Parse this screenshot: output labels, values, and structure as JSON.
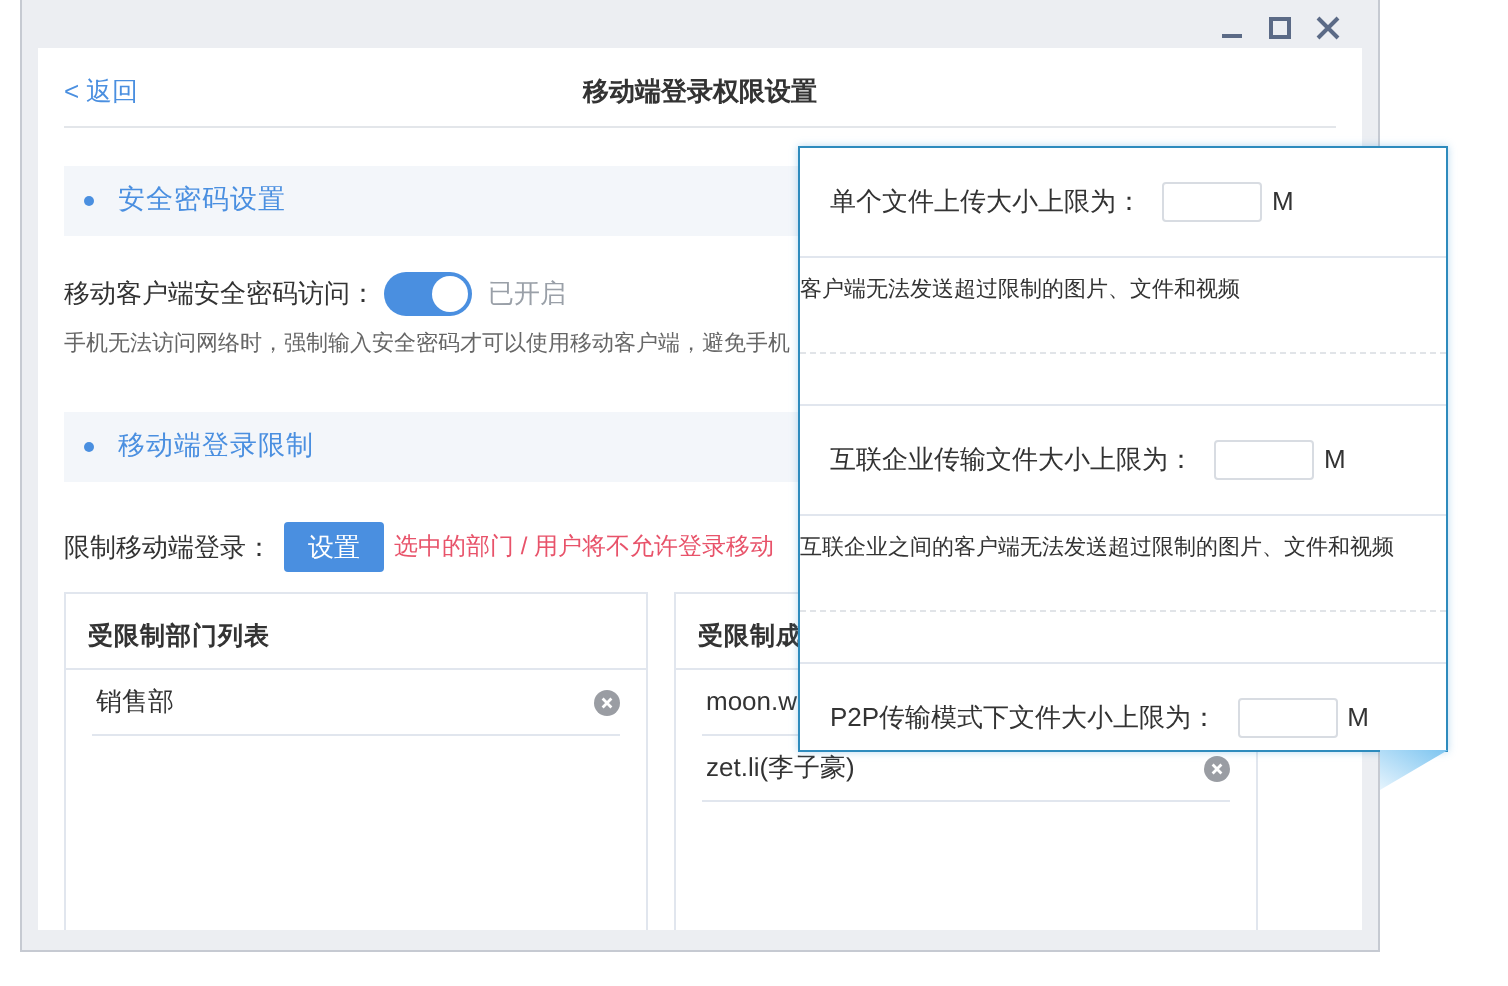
{
  "header": {
    "back": "< 返回",
    "title": "移动端登录权限设置"
  },
  "password_section": {
    "title": "安全密码设置",
    "toggle_label": "移动客户端安全密码访问：",
    "on": true,
    "status": "已开启",
    "description": "手机无法访问网络时，强制输入安全密码才可以使用移动客户端，避免手机"
  },
  "login_section": {
    "title": "移动端登录限制",
    "label": "限制移动端登录：",
    "button": "设置",
    "hint": "选中的部门 / 用户将不允许登录移动"
  },
  "lists": [
    {
      "title": "受限制部门列表",
      "items": [
        {
          "text": "销售部",
          "remove_icon": true
        }
      ]
    },
    {
      "title": "受限制成",
      "items": [
        {
          "text": "moon.w",
          "remove_icon": false
        },
        {
          "text": "zet.li(李子豪)",
          "remove_icon": true
        }
      ]
    }
  ],
  "popup": {
    "limits": [
      {
        "label": "单个文件上传大小上限为：",
        "unit": "M",
        "note": "客户端无法发送超过限制的图片、文件和视频"
      },
      {
        "label": "互联企业传输文件大小上限为：",
        "unit": "M",
        "note": "互联企业之间的客户端无法发送超过限制的图片、文件和视频"
      },
      {
        "label": "P2P传输模式下文件大小上限为：",
        "unit": "M"
      }
    ]
  }
}
